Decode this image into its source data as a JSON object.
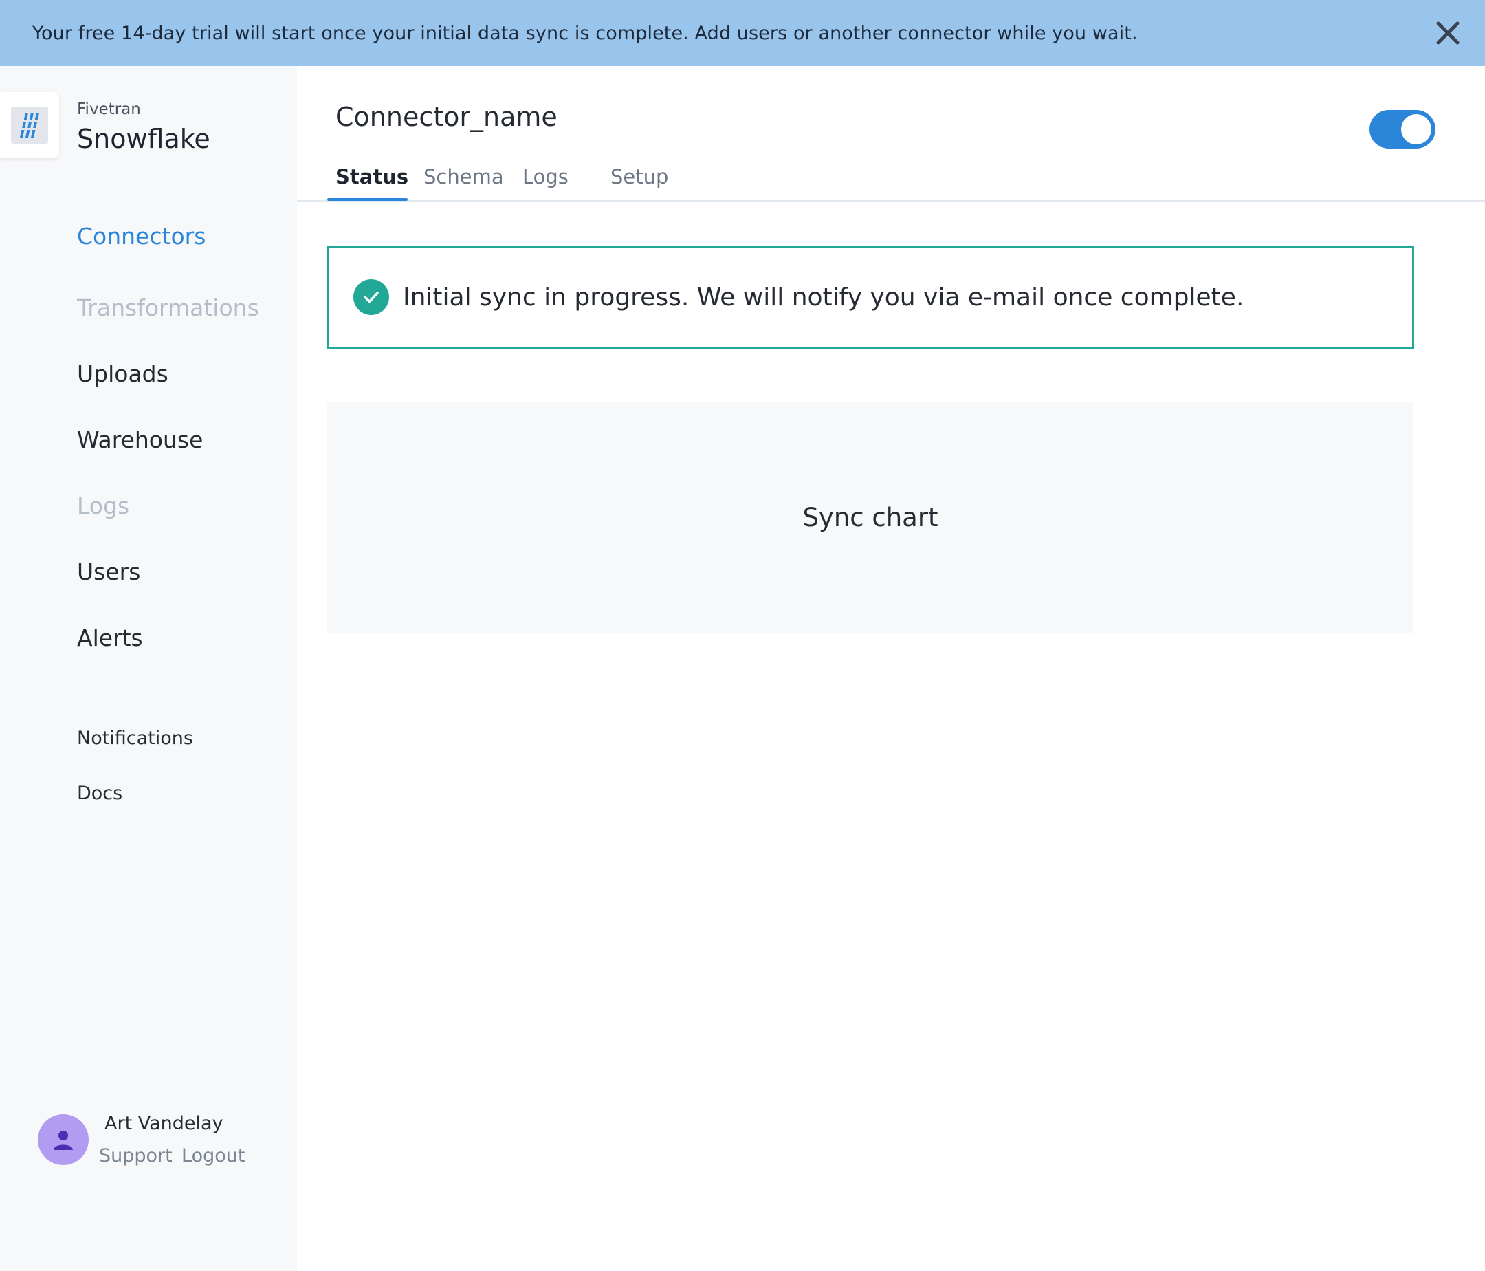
{
  "banner": {
    "text": "Your free 14-day trial will start once your initial data sync is complete. Add users or another connector while you wait.",
    "close_icon": "close-icon"
  },
  "brand": {
    "company": "Fivetran",
    "destination": "Snowflake",
    "logo_icon": "snowflake-logo-icon"
  },
  "sidebar": {
    "items": [
      {
        "label": "Connectors",
        "state": "active"
      },
      {
        "label": "Transformations",
        "state": "disabled"
      },
      {
        "label": "Uploads",
        "state": "normal"
      },
      {
        "label": "Warehouse",
        "state": "normal"
      },
      {
        "label": "Logs",
        "state": "disabled"
      },
      {
        "label": "Users",
        "state": "normal"
      },
      {
        "label": "Alerts",
        "state": "normal"
      }
    ],
    "secondary": [
      {
        "label": "Notifications"
      },
      {
        "label": "Docs"
      }
    ]
  },
  "user": {
    "name": "Art Vandelay",
    "support_label": "Support",
    "logout_label": "Logout",
    "avatar_icon": "user-icon"
  },
  "connector": {
    "name": "Connector_name",
    "enabled": true,
    "tabs": [
      {
        "label": "Status",
        "active": true
      },
      {
        "label": "Schema",
        "active": false
      },
      {
        "label": "Logs",
        "active": false
      },
      {
        "label": "Setup",
        "active": false
      }
    ]
  },
  "status": {
    "message": "Initial sync in progress. We will notify you via e-mail once complete.",
    "icon": "check-circle-icon"
  },
  "chart_placeholder": {
    "label": "Sync chart"
  },
  "colors": {
    "banner": "#99c4ec",
    "accent": "#2b86d9",
    "success": "#22a897",
    "sidebar_bg": "#f7f8fa",
    "avatar": "#b19cf2"
  }
}
